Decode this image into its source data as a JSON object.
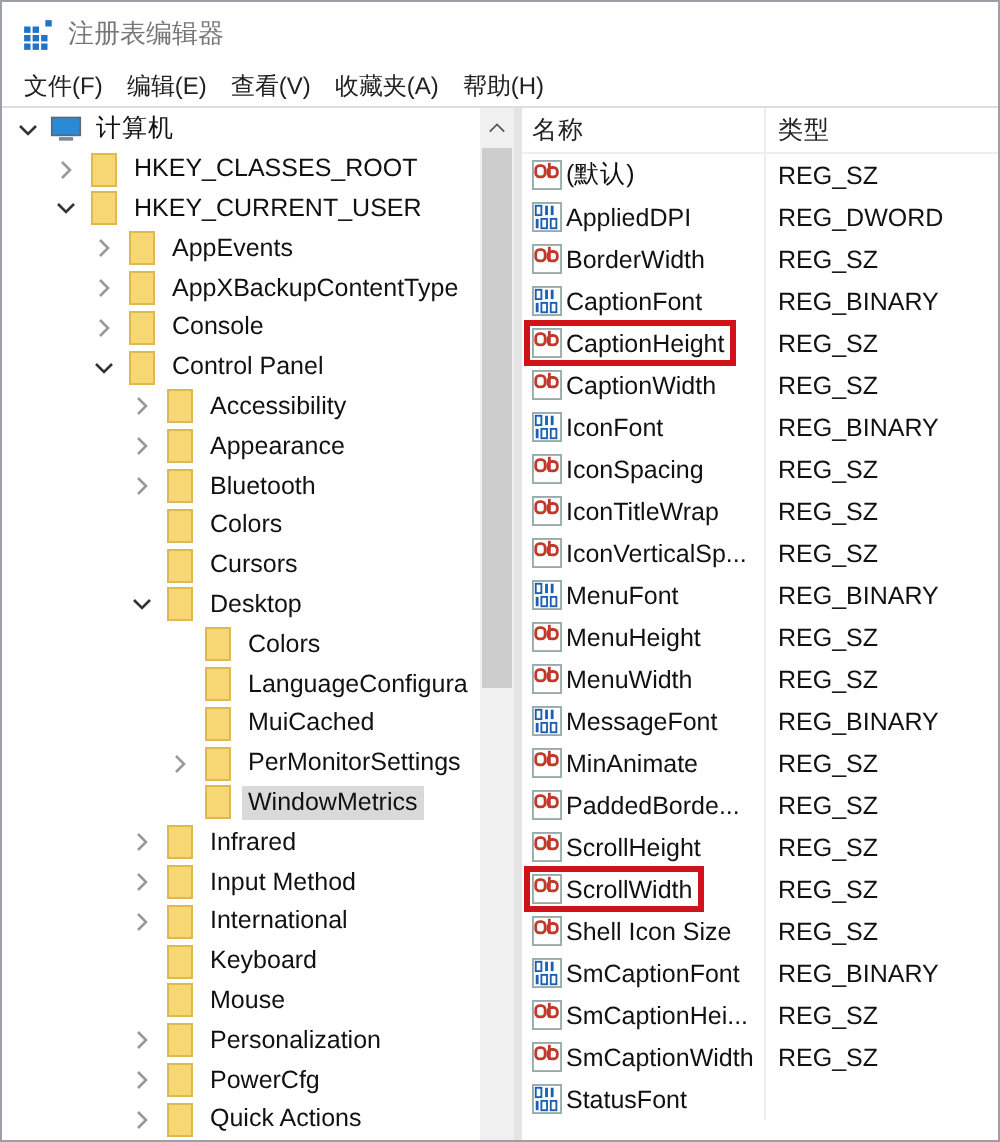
{
  "window": {
    "title": "注册表编辑器"
  },
  "menu": [
    "文件(F)",
    "编辑(E)",
    "查看(V)",
    "收藏夹(A)",
    "帮助(H)"
  ],
  "tree": [
    {
      "label": "计算机",
      "kind": "computer",
      "expanded": true,
      "selected": false,
      "children": [
        {
          "label": "HKEY_CLASSES_ROOT",
          "kind": "folder",
          "expanded": false,
          "selected": false
        },
        {
          "label": "HKEY_CURRENT_USER",
          "kind": "folder",
          "expanded": true,
          "selected": false,
          "children": [
            {
              "label": "AppEvents",
              "kind": "folder",
              "expanded": false,
              "selected": false
            },
            {
              "label": "AppXBackupContentType",
              "kind": "folder",
              "expanded": false,
              "selected": false
            },
            {
              "label": "Console",
              "kind": "folder",
              "expanded": false,
              "selected": false
            },
            {
              "label": "Control Panel",
              "kind": "folder",
              "expanded": true,
              "selected": false,
              "children": [
                {
                  "label": "Accessibility",
                  "kind": "folder",
                  "expanded": false,
                  "selected": false
                },
                {
                  "label": "Appearance",
                  "kind": "folder",
                  "expanded": false,
                  "selected": false
                },
                {
                  "label": "Bluetooth",
                  "kind": "folder",
                  "expanded": false,
                  "selected": false
                },
                {
                  "label": "Colors",
                  "kind": "folder",
                  "selected": false
                },
                {
                  "label": "Cursors",
                  "kind": "folder",
                  "selected": false
                },
                {
                  "label": "Desktop",
                  "kind": "folder",
                  "expanded": true,
                  "selected": false,
                  "children": [
                    {
                      "label": "Colors",
                      "kind": "folder",
                      "selected": false
                    },
                    {
                      "label": "LanguageConfigura",
                      "kind": "folder",
                      "selected": false
                    },
                    {
                      "label": "MuiCached",
                      "kind": "folder",
                      "selected": false
                    },
                    {
                      "label": "PerMonitorSettings",
                      "kind": "folder",
                      "expanded": false,
                      "selected": false
                    },
                    {
                      "label": "WindowMetrics",
                      "kind": "folder",
                      "selected": true
                    }
                  ]
                },
                {
                  "label": "Infrared",
                  "kind": "folder",
                  "expanded": false,
                  "selected": false
                },
                {
                  "label": "Input Method",
                  "kind": "folder",
                  "expanded": false,
                  "selected": false
                },
                {
                  "label": "International",
                  "kind": "folder",
                  "expanded": false,
                  "selected": false
                },
                {
                  "label": "Keyboard",
                  "kind": "folder",
                  "selected": false
                },
                {
                  "label": "Mouse",
                  "kind": "folder",
                  "selected": false
                },
                {
                  "label": "Personalization",
                  "kind": "folder",
                  "expanded": false,
                  "selected": false
                },
                {
                  "label": "PowerCfg",
                  "kind": "folder",
                  "expanded": false,
                  "selected": false
                },
                {
                  "label": "Quick Actions",
                  "kind": "folder",
                  "expanded": false,
                  "selected": false
                }
              ]
            }
          ]
        }
      ]
    }
  ],
  "table": {
    "columns": [
      "名称",
      "类型"
    ],
    "rows": [
      {
        "name": "(默认)",
        "type": "REG_SZ",
        "kind": "string",
        "highlighted": false
      },
      {
        "name": "AppliedDPI",
        "type": "REG_DWORD",
        "kind": "binary",
        "highlighted": false
      },
      {
        "name": "BorderWidth",
        "type": "REG_SZ",
        "kind": "string",
        "highlighted": false
      },
      {
        "name": "CaptionFont",
        "type": "REG_BINARY",
        "kind": "binary",
        "highlighted": false
      },
      {
        "name": "CaptionHeight",
        "type": "REG_SZ",
        "kind": "string",
        "highlighted": true
      },
      {
        "name": "CaptionWidth",
        "type": "REG_SZ",
        "kind": "string",
        "highlighted": false
      },
      {
        "name": "IconFont",
        "type": "REG_BINARY",
        "kind": "binary",
        "highlighted": false
      },
      {
        "name": "IconSpacing",
        "type": "REG_SZ",
        "kind": "string",
        "highlighted": false
      },
      {
        "name": "IconTitleWrap",
        "type": "REG_SZ",
        "kind": "string",
        "highlighted": false
      },
      {
        "name": "IconVerticalSp...",
        "type": "REG_SZ",
        "kind": "string",
        "highlighted": false
      },
      {
        "name": "MenuFont",
        "type": "REG_BINARY",
        "kind": "binary",
        "highlighted": false
      },
      {
        "name": "MenuHeight",
        "type": "REG_SZ",
        "kind": "string",
        "highlighted": false
      },
      {
        "name": "MenuWidth",
        "type": "REG_SZ",
        "kind": "string",
        "highlighted": false
      },
      {
        "name": "MessageFont",
        "type": "REG_BINARY",
        "kind": "binary",
        "highlighted": false
      },
      {
        "name": "MinAnimate",
        "type": "REG_SZ",
        "kind": "string",
        "highlighted": false
      },
      {
        "name": "PaddedBorde...",
        "type": "REG_SZ",
        "kind": "string",
        "highlighted": false
      },
      {
        "name": "ScrollHeight",
        "type": "REG_SZ",
        "kind": "string",
        "highlighted": false
      },
      {
        "name": "ScrollWidth",
        "type": "REG_SZ",
        "kind": "string",
        "highlighted": true
      },
      {
        "name": "Shell Icon Size",
        "type": "REG_SZ",
        "kind": "string",
        "highlighted": false
      },
      {
        "name": "SmCaptionFont",
        "type": "REG_BINARY",
        "kind": "binary",
        "highlighted": false
      },
      {
        "name": "SmCaptionHei...",
        "type": "REG_SZ",
        "kind": "string",
        "highlighted": false
      },
      {
        "name": "SmCaptionWidth",
        "type": "REG_SZ",
        "kind": "string",
        "highlighted": false
      },
      {
        "name": "StatusFont",
        "kind": "binary",
        "highlighted": false
      }
    ]
  }
}
